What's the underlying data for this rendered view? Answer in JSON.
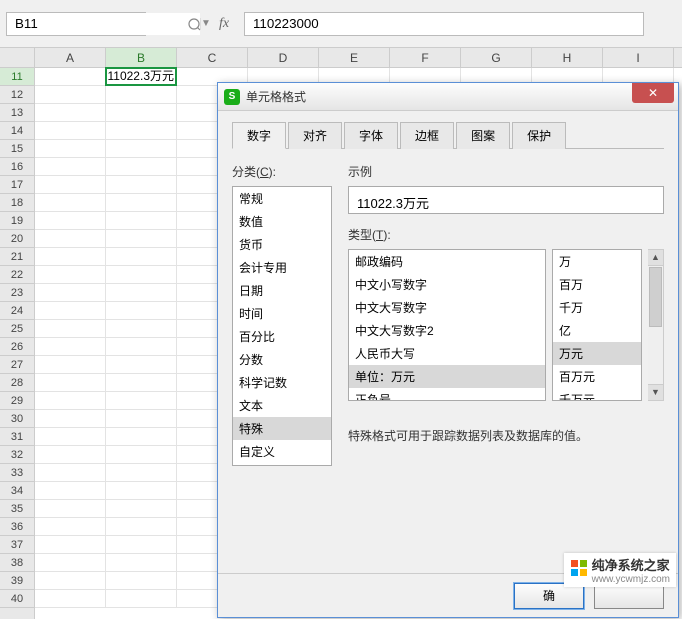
{
  "topbar": {
    "namebox_value": "B11",
    "formula_value": "110223000"
  },
  "columns": [
    "A",
    "B",
    "C",
    "D",
    "E",
    "F",
    "G",
    "H",
    "I"
  ],
  "rows": [
    "11",
    "12",
    "13",
    "14",
    "15",
    "16",
    "17",
    "18",
    "19",
    "20",
    "21",
    "22",
    "23",
    "24",
    "25",
    "26",
    "27",
    "28",
    "29",
    "30",
    "31",
    "32",
    "33",
    "34",
    "35",
    "36",
    "37",
    "38",
    "39",
    "40"
  ],
  "selected_col_idx": 1,
  "selected_row_idx": 0,
  "cell_b11": "11022.3万元",
  "dialog": {
    "title": "单元格格式",
    "tabs": [
      "数字",
      "对齐",
      "字体",
      "边框",
      "图案",
      "保护"
    ],
    "active_tab": 0,
    "category_label_pre": "分类(",
    "category_label_hot": "C",
    "category_label_post": "):",
    "categories": [
      "常规",
      "数值",
      "货币",
      "会计专用",
      "日期",
      "时间",
      "百分比",
      "分数",
      "科学记数",
      "文本",
      "特殊",
      "自定义"
    ],
    "selected_category_idx": 10,
    "preview_label": "示例",
    "preview_value": "11022.3万元",
    "type_label_pre": "类型(",
    "type_label_hot": "T",
    "type_label_post": "):",
    "types_left": [
      "邮政编码",
      "中文小写数字",
      "中文大写数字",
      "中文大写数字2",
      "人民币大写",
      "单位：万元",
      "正负号"
    ],
    "selected_type_left_idx": 5,
    "types_right": [
      "万",
      "百万",
      "千万",
      "亿",
      "万元",
      "百万元",
      "千万元"
    ],
    "selected_type_right_idx": 4,
    "description": "特殊格式可用于跟踪数据列表及数据库的值。",
    "ok_label": "确",
    "cancel_label": ""
  },
  "watermark": {
    "name": "纯净系统之家",
    "url": "www.ycwmjz.com"
  }
}
